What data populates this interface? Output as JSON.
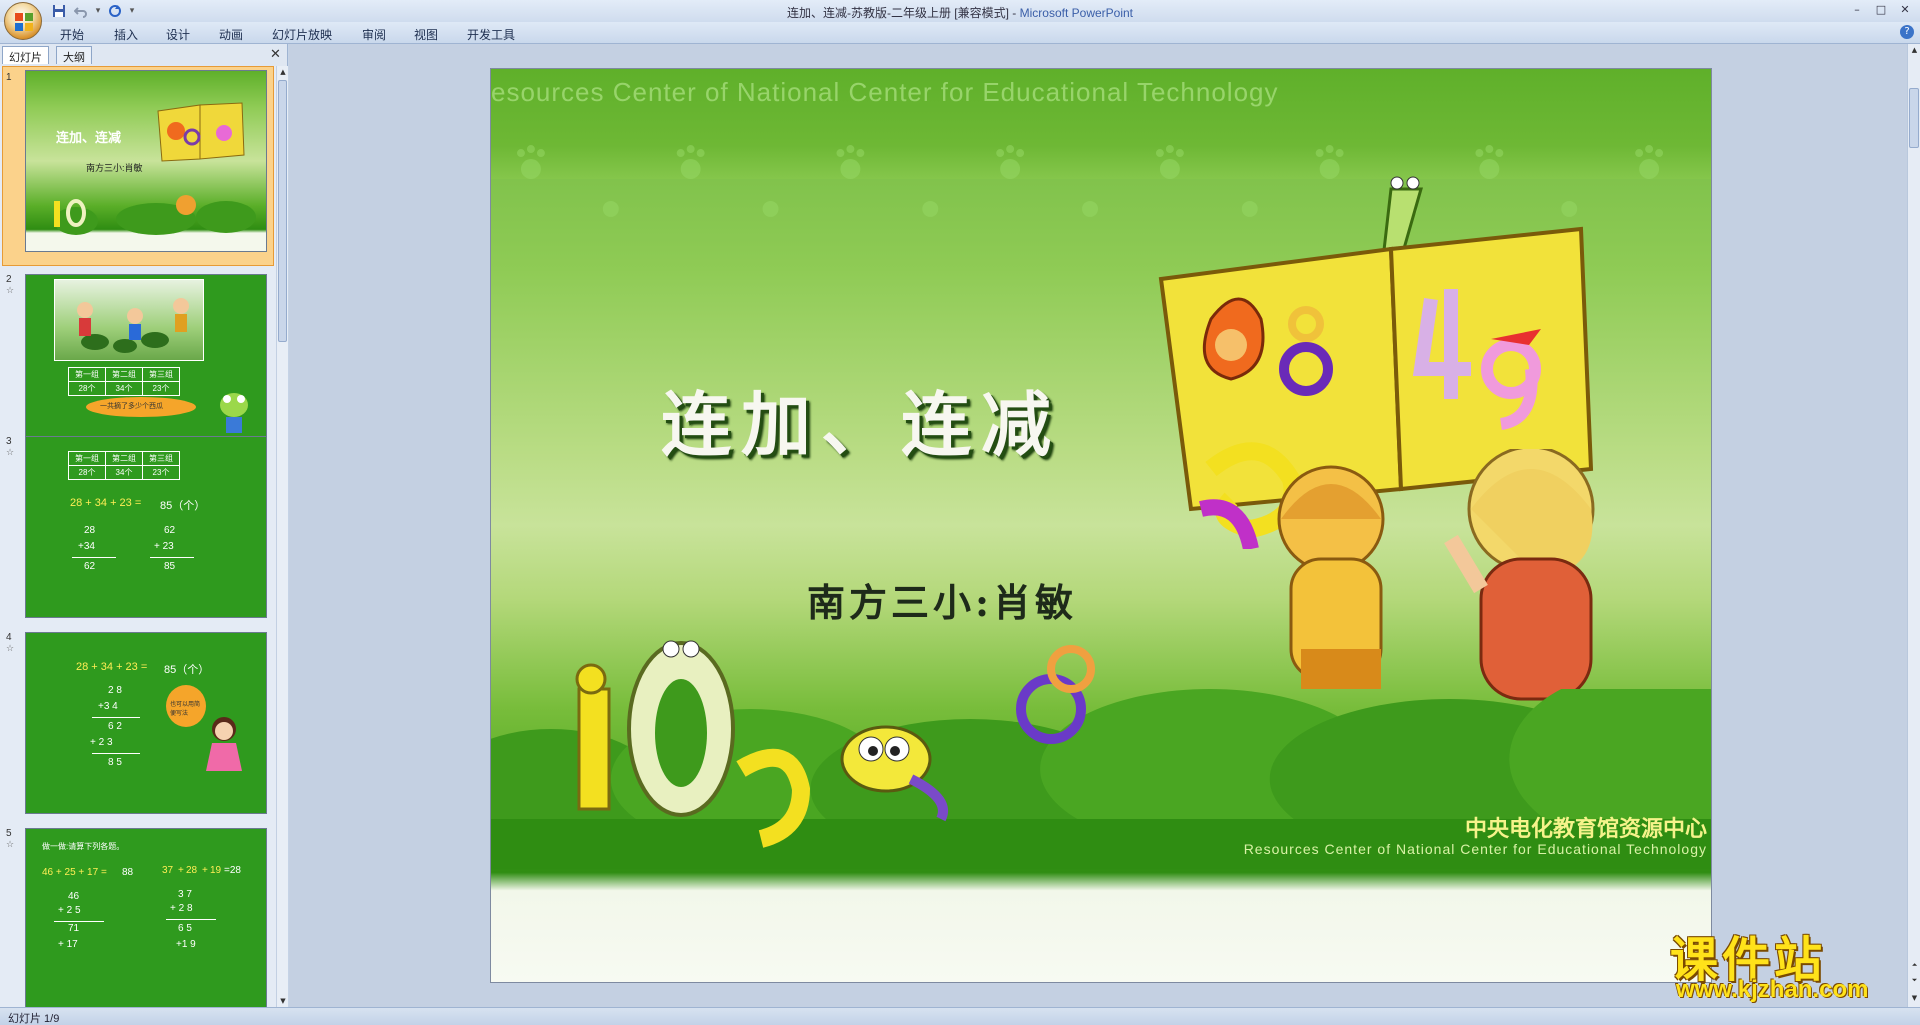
{
  "window": {
    "title_doc": "连加、连减-苏教版-二年级上册 [兼容模式]",
    "title_sep": " - ",
    "title_app": "Microsoft PowerPoint",
    "minimize": "–",
    "maximize": "□",
    "close": "✕"
  },
  "ribbon": {
    "tabs": [
      "开始",
      "插入",
      "设计",
      "动画",
      "幻灯片放映",
      "审阅",
      "视图",
      "开发工具"
    ],
    "help": "?"
  },
  "pane": {
    "tab_slides": "幻灯片",
    "tab_outline": "大纲",
    "close": "✕"
  },
  "thumbnails": [
    {
      "num": "1",
      "title": "连加、连减",
      "subtitle": "南方三小:肖敏"
    },
    {
      "num": "2",
      "star": "☆",
      "table_head": [
        "第一组",
        "第二组",
        "第三组"
      ],
      "table_vals": [
        "28个",
        "34个",
        "23个"
      ],
      "bubble": "一共摘了多少个西瓜"
    },
    {
      "num": "3",
      "star": "☆",
      "table_head": [
        "第一组",
        "第二组",
        "第三组"
      ],
      "table_vals": [
        "28个",
        "34个",
        "23个"
      ],
      "equation": "28 + 34 + 23 =",
      "answer": "85（个）",
      "col1": [
        "28",
        "+34",
        "62"
      ],
      "col2": [
        "62",
        "+ 23",
        "85"
      ]
    },
    {
      "num": "4",
      "star": "☆",
      "equation": "28 + 34 + 23 =",
      "answer": "85（个）",
      "lines": [
        "2 8",
        "+3 4",
        "6 2",
        "+ 2 3",
        "8 5"
      ],
      "bubble": "也可以用简便写法"
    },
    {
      "num": "5",
      "star": "☆",
      "heading": "做一做:请算下列各题。",
      "eq1": "46 + 25 + 17 =",
      "ans1": "88",
      "eq2": "37",
      "eq2b": "28",
      "eq2c": "19",
      "ans2": "=28",
      "col1": [
        "46",
        "+ 2 5",
        "71",
        "+ 17"
      ],
      "col2": [
        "3 7",
        "+ 2 8",
        "6 5",
        "+1 9"
      ]
    }
  ],
  "slide": {
    "watermark": "esources Center of National  Center for Educational Technology",
    "title": "连加、连减",
    "subtitle": "南方三小:肖敏",
    "center_cn": "中央电化教育馆资源中心",
    "center_en": "Resources Center of National Center for Educational Technology"
  },
  "status": {
    "slide_count": "幻灯片 1/9"
  },
  "site_watermark": {
    "cn": "课件站",
    "url": "www.kjzhan.com"
  },
  "colors": {
    "slide_green": "#6db93a",
    "selected_thumb": "#fbd28b",
    "ribbon_bg": "#dfe9f6"
  }
}
